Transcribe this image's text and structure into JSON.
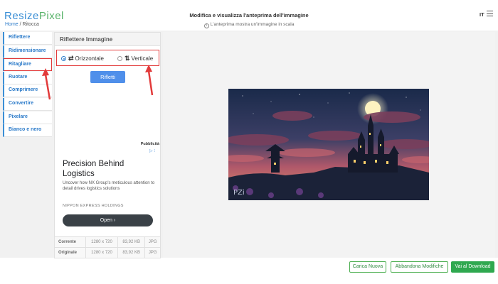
{
  "header": {
    "logo_part1": "Resize",
    "logo_part2": "Pixel",
    "breadcrumb_home": "Home",
    "breadcrumb_sep": " / ",
    "breadcrumb_current": "Ritocca",
    "title": "Modifica e visualizza l'anteprima dell'immagine",
    "subtitle": "L'anteprima mostra un'immagine in scala",
    "info_glyph": "i",
    "language": "IT"
  },
  "sidebar": {
    "items": [
      {
        "label": "Riflettere"
      },
      {
        "label": "Ridimensionare"
      },
      {
        "label": "Ritagliare"
      },
      {
        "label": "Ruotare"
      },
      {
        "label": "Comprimere"
      },
      {
        "label": "Convertire"
      },
      {
        "label": "Pixelare"
      },
      {
        "label": "Bianco e nero"
      }
    ]
  },
  "panel": {
    "title": "Riflettere Immagine",
    "option_horizontal": "Orizzontale",
    "option_vertical": "Verticale",
    "horizontal_symbol": "⇄",
    "vertical_symbol": "⇅",
    "flip_button": "Rifletti"
  },
  "ad": {
    "label": "Pubblicità",
    "choice_glyph": "▷ ⁝",
    "headline": "Precision Behind Logistics",
    "body": "Uncover how NX Group's meticulous attention to detail drives logistics solutions",
    "brand": "NIPPON EXPRESS HOLDINGS",
    "cta": "Open",
    "cta_arrow": "›"
  },
  "info_table": {
    "rows": [
      {
        "label": "Corrente",
        "dimensions": "1280 x 720",
        "size": "83,92 KB",
        "format": "JPG"
      },
      {
        "label": "Originale",
        "dimensions": "1280 x 720",
        "size": "83,92 KB",
        "format": "JPG"
      }
    ]
  },
  "preview": {
    "watermark": "PZi"
  },
  "footer": {
    "upload_new": "Carica Nuova",
    "discard_changes": "Abbandona Modifiche",
    "download": "Vai al Download"
  },
  "colors": {
    "brand_blue": "#3b8fd6",
    "brand_green": "#59b36a",
    "annotation_red": "#e23a3a",
    "primary_button": "#4f8fea",
    "download_green": "#2fa84f"
  }
}
